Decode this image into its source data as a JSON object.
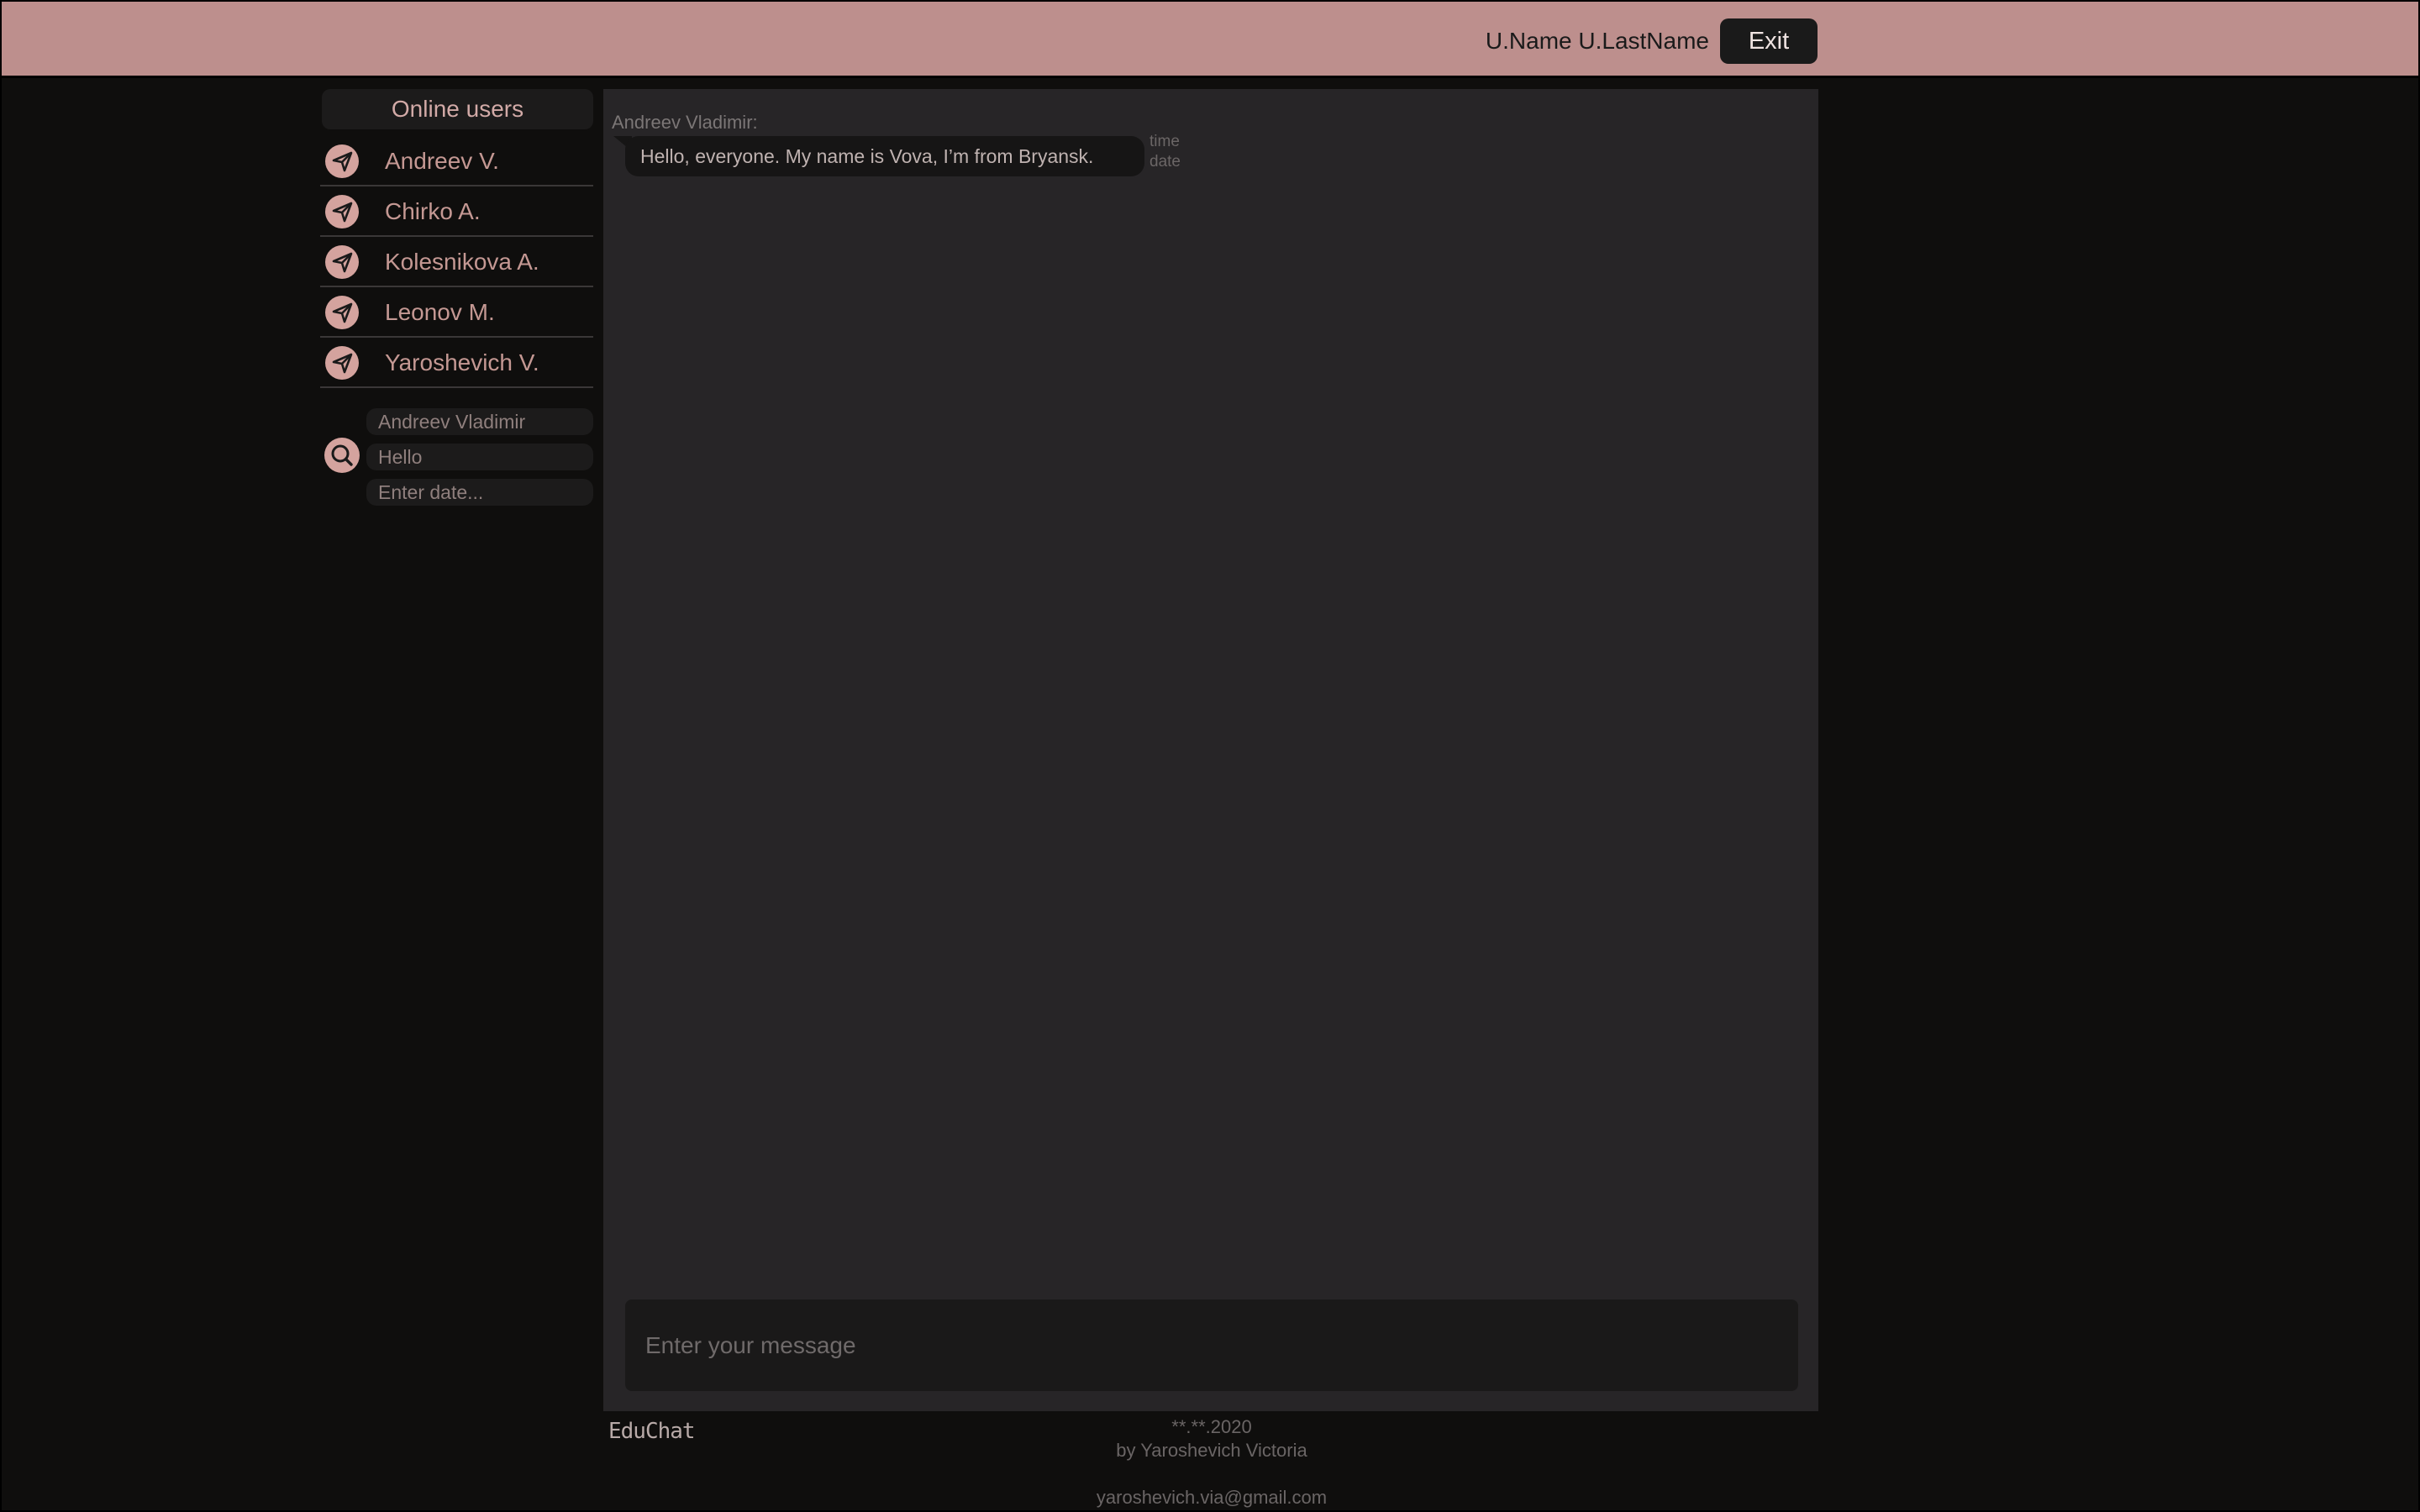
{
  "colors": {
    "header_bg": "#bd8f8d",
    "page_bg": "#0f0e0d",
    "panel_bg": "#272527",
    "accent": "#d4a39e"
  },
  "header": {
    "user_name": "U.Name U.LastName",
    "exit_label": "Exit"
  },
  "sidebar": {
    "title": "Online users",
    "users": [
      {
        "name": "Andreev V.",
        "icon": "send-icon"
      },
      {
        "name": "Chirko A.",
        "icon": "send-icon"
      },
      {
        "name": "Kolesnikova A.",
        "icon": "send-icon"
      },
      {
        "name": "Leonov M.",
        "icon": "send-icon"
      },
      {
        "name": "Yaroshevich V.",
        "icon": "send-icon"
      }
    ],
    "search": {
      "icon": "search-icon",
      "author_value": "Andreev Vladimir",
      "text_value": "Hello",
      "date_placeholder": "Enter date..."
    }
  },
  "chat": {
    "messages": [
      {
        "sender": "Andreev Vladimir:",
        "text": "Hello, everyone. My name is Vova, I’m from Bryansk.",
        "time": "time",
        "date": "date"
      }
    ],
    "composer_placeholder": "Enter your message"
  },
  "footer": {
    "logo": "EduChat",
    "date": "**.**.2020",
    "author": "by Yaroshevich Victoria",
    "email": "yaroshevich.via@gmail.com"
  }
}
